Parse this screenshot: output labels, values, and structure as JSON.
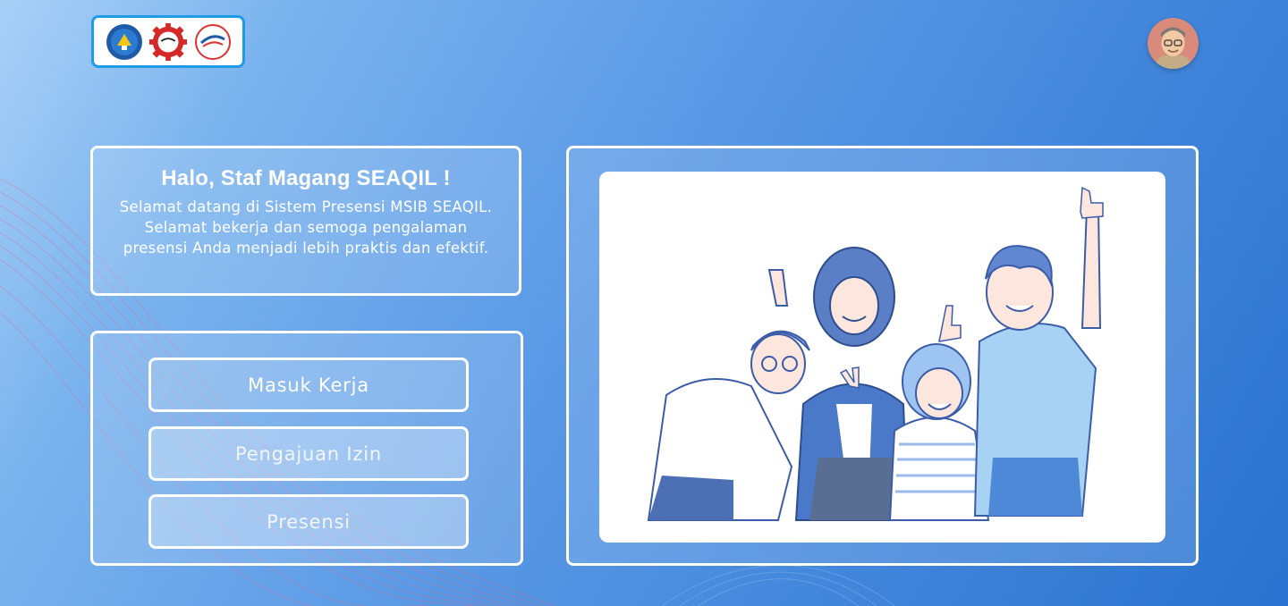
{
  "header": {
    "logos": [
      {
        "name": "kemendikbud-logo",
        "icon": "tut-wuri-handayani-emblem"
      },
      {
        "name": "seameo-logo",
        "icon": "seameo-gear-emblem"
      },
      {
        "name": "seameo-seaqil-logo",
        "icon": "seaqil-circle-emblem"
      }
    ],
    "avatar": {
      "icon": "user-avatar-3d"
    }
  },
  "welcome": {
    "title": "Halo, Staf Magang SEAQIL !",
    "message": "Selamat datang di Sistem Presensi MSIB SEAQIL. Selamat bekerja dan semoga pengalaman presensi Anda menjadi lebih praktis dan efektif."
  },
  "actions": {
    "masuk_kerja": "Masuk Kerja",
    "pengajuan_izin": "Pengajuan Izin",
    "presensi": "Presensi"
  },
  "illustration": {
    "icon": "happy-team-illustration"
  },
  "colors": {
    "accent": "#1e9be6",
    "panel_border": "#ffffff",
    "background_start": "#a9d0f7",
    "background_end": "#2a72cf"
  }
}
